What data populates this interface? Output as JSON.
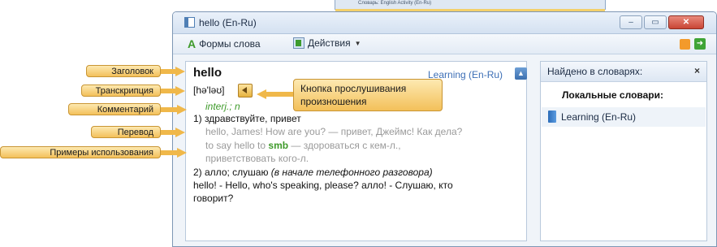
{
  "background_window": {
    "caption": "Словарь: English Activity (En-Ru)"
  },
  "window": {
    "title": "hello (En-Ru)",
    "controls": {
      "minimize": "–",
      "maximize": "▭",
      "close": "✕"
    }
  },
  "toolbar": {
    "word_forms": "Формы слова",
    "actions": "Действия"
  },
  "article": {
    "headword": "hello",
    "dictionary": "Learning (En-Ru)",
    "transcription": "[hə'ləʊ]",
    "grammar": "interj.; n",
    "sense1": "1) здравствуйте, привет",
    "example1": "hello, James! How are you? — привет, Джеймс! Как дела?",
    "example2_prefix": "to say hello to ",
    "example2_term": "smb",
    "example2_suffix": " — здороваться с кем-л.,",
    "example3": "приветствовать кого-л.",
    "sense2_text": "2) алло; слушаю ",
    "sense2_note": "(в начале телефонного разговора)",
    "example4": "hello! - Hello, who's speaking, please? алло! - Слушаю, кто",
    "example5": "говорит?"
  },
  "found_pane": {
    "title": "Найдено в словарях:",
    "close": "×",
    "local_title": "Локальные словари:",
    "items": [
      {
        "label": "Learning (En-Ru)"
      }
    ]
  },
  "callouts": {
    "heading": "Заголовок",
    "transcription": "Транскрипция",
    "comment": "Комментарий",
    "translation": "Перевод",
    "examples": "Примеры использования",
    "listen_button_line1": "Кнопка прослушивания",
    "listen_button_line2": "произношения"
  },
  "colors": {
    "callout_fill": "#f3c05a",
    "link_blue": "#3d6fb6",
    "grammar_green": "#3e9a2a",
    "example_gray": "#9a9a9a"
  }
}
